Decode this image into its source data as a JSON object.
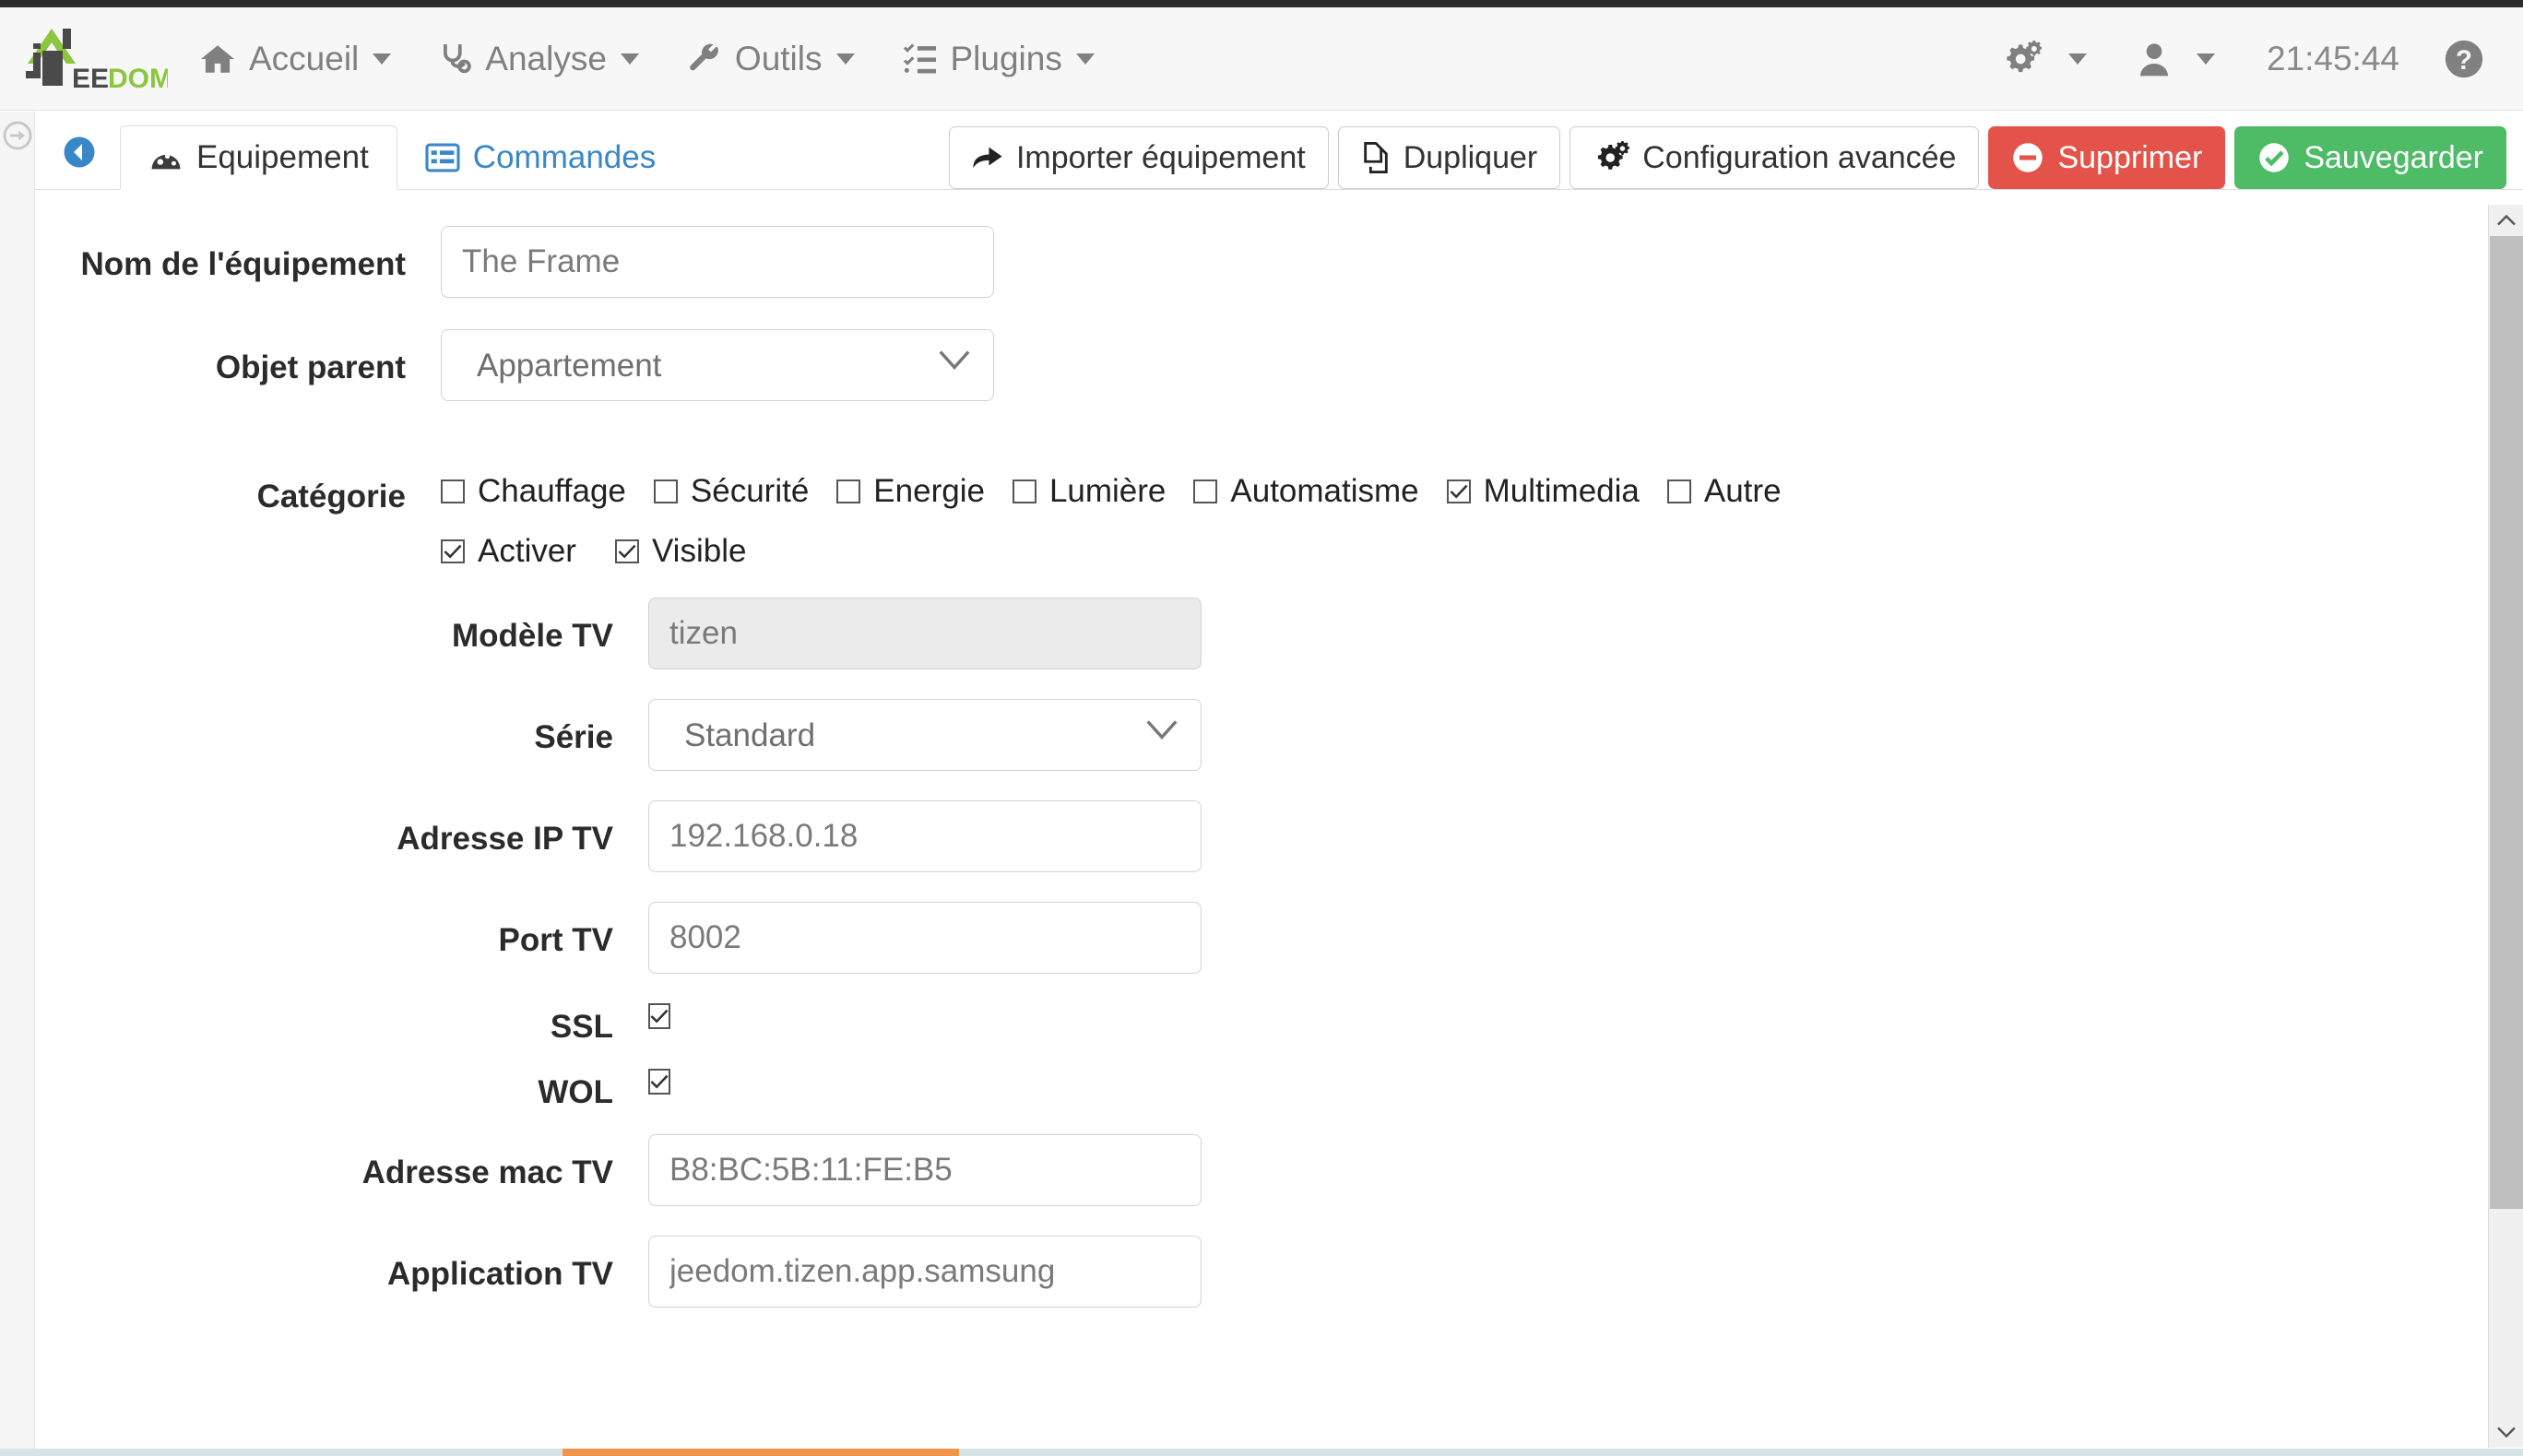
{
  "brand": {
    "name_dark": "EE",
    "name_accent": "DOM",
    "accent_color": "#8cc63e",
    "dark_color": "#4a4a4a"
  },
  "navbar": {
    "items": [
      {
        "label": "Accueil",
        "icon": "home-icon",
        "has_caret": true
      },
      {
        "label": "Analyse",
        "icon": "stethoscope-icon",
        "has_caret": true
      },
      {
        "label": "Outils",
        "icon": "wrench-icon",
        "has_caret": true
      },
      {
        "label": "Plugins",
        "icon": "list-check-icon",
        "has_caret": true
      }
    ],
    "right": {
      "gear_icon": "gears-icon",
      "user_icon": "user-icon",
      "clock": "21:45:44",
      "help_icon": "question-circle-icon"
    }
  },
  "sidebar": {
    "toggle_icon": "arrow-circle-right-icon"
  },
  "toolbar": {
    "back_icon": "arrow-circle-left-icon",
    "tabs": [
      {
        "label": "Equipement",
        "icon": "dashboard-icon",
        "active": true
      },
      {
        "label": "Commandes",
        "icon": "list-alt-icon",
        "active": false
      }
    ],
    "buttons": [
      {
        "label": "Importer équipement",
        "icon": "share-icon",
        "style": "default"
      },
      {
        "label": "Dupliquer",
        "icon": "copy-icon",
        "style": "default"
      },
      {
        "label": "Configuration avancée",
        "icon": "gears-icon",
        "style": "default"
      },
      {
        "label": "Supprimer",
        "icon": "minus-circle-icon",
        "style": "danger"
      },
      {
        "label": "Sauvegarder",
        "icon": "check-circle-icon",
        "style": "success"
      }
    ],
    "colors": {
      "danger": "#e4534a",
      "success": "#4ebb67",
      "link": "#3a87c8"
    }
  },
  "form": {
    "nom_label": "Nom de l'équipement",
    "nom_value": "The Frame",
    "objet_label": "Objet parent",
    "objet_value": "Appartement",
    "categorie_label": "Catégorie",
    "categories": [
      {
        "label": "Chauffage",
        "checked": false
      },
      {
        "label": "Sécurité",
        "checked": false
      },
      {
        "label": "Energie",
        "checked": false
      },
      {
        "label": "Lumière",
        "checked": false
      },
      {
        "label": "Automatisme",
        "checked": false
      },
      {
        "label": "Multimedia",
        "checked": true
      },
      {
        "label": "Autre",
        "checked": false
      }
    ],
    "toggles": [
      {
        "label": "Activer",
        "checked": true
      },
      {
        "label": "Visible",
        "checked": true
      }
    ],
    "modele_label": "Modèle TV",
    "modele_value": "tizen",
    "serie_label": "Série",
    "serie_value": "Standard",
    "ip_label": "Adresse IP TV",
    "ip_value": "192.168.0.18",
    "port_label": "Port TV",
    "port_value": "8002",
    "ssl_label": "SSL",
    "ssl_checked": true,
    "wol_label": "WOL",
    "wol_checked": true,
    "mac_label": "Adresse mac TV",
    "mac_value": "B8:BC:5B:11:FE:B5",
    "app_label": "Application TV",
    "app_value": "jeedom.tizen.app.samsung"
  },
  "scrollbars": {
    "progress_color": "#f0954a"
  }
}
